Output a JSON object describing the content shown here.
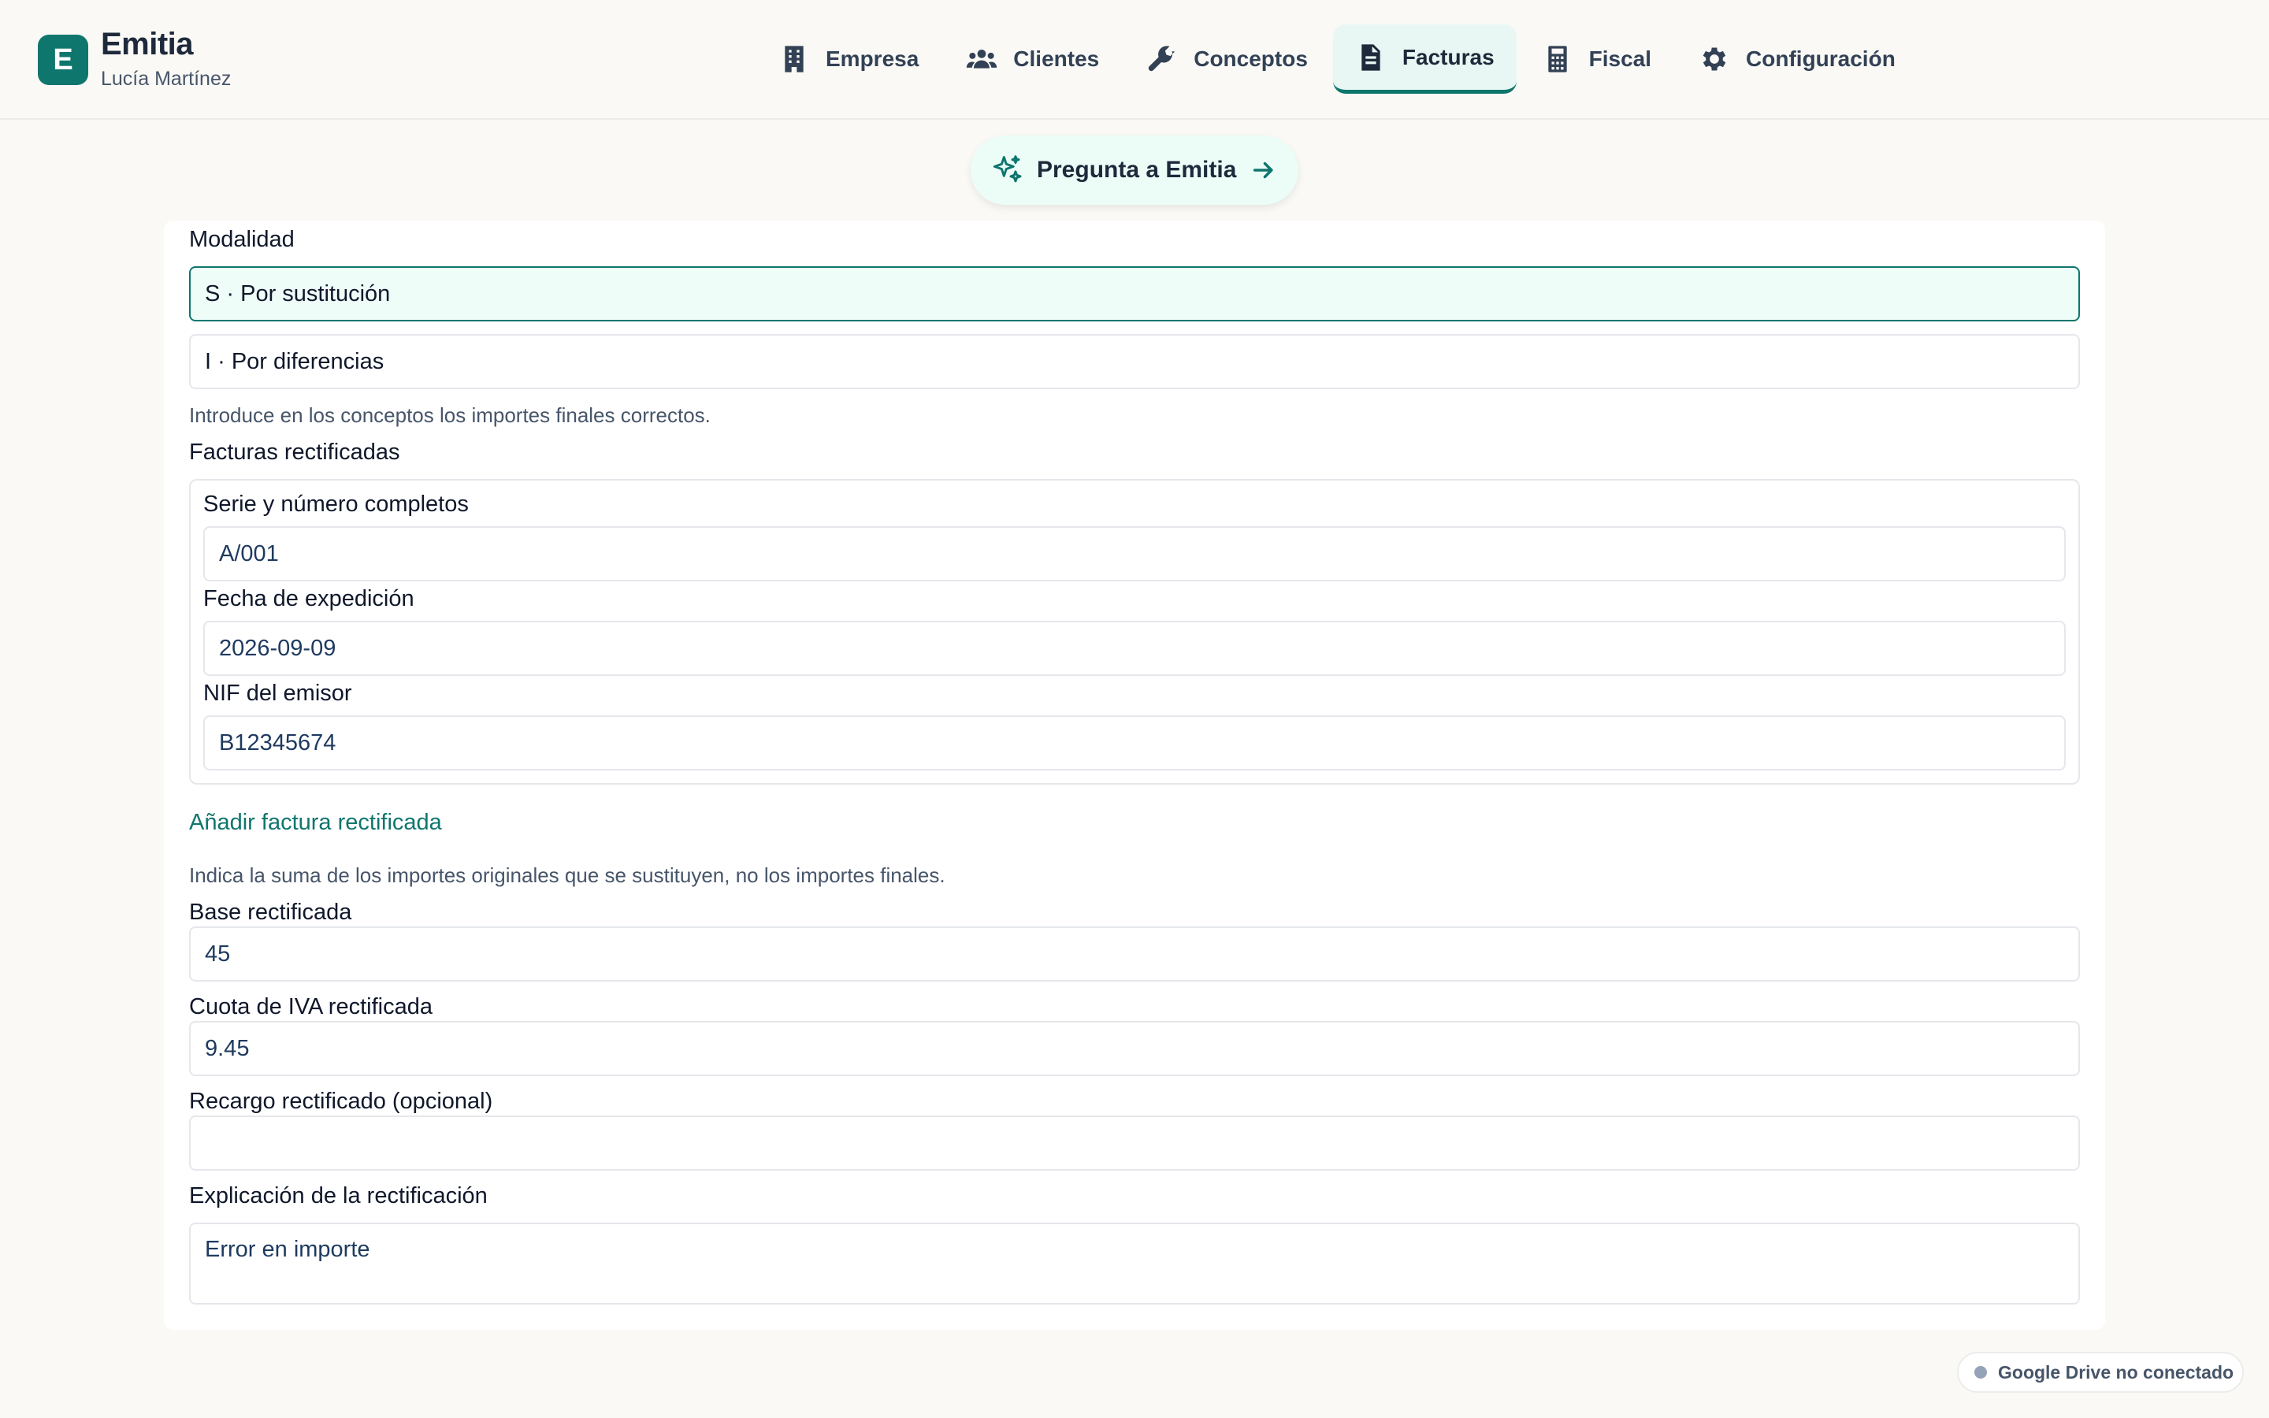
{
  "brand": {
    "initial": "E",
    "name": "Emitia",
    "user": "Lucía Martínez"
  },
  "nav": [
    {
      "label": "Empresa",
      "icon": "building-icon",
      "active": false
    },
    {
      "label": "Clientes",
      "icon": "users-icon",
      "active": false
    },
    {
      "label": "Conceptos",
      "icon": "wrench-icon",
      "active": false
    },
    {
      "label": "Facturas",
      "icon": "document-icon",
      "active": true
    },
    {
      "label": "Fiscal",
      "icon": "calculator-icon",
      "active": false
    },
    {
      "label": "Configuración",
      "icon": "gear-icon",
      "active": false
    }
  ],
  "ask": {
    "label": "Pregunta a Emitia"
  },
  "form": {
    "modalidad_label": "Modalidad",
    "options": [
      "S · Por sustitución",
      "I · Por diferencias"
    ],
    "selected_option": "S · Por sustitución",
    "modalidad_help": "Introduce en los conceptos los importes finales correctos.",
    "rectificadas_label": "Facturas rectificadas",
    "rectificada": {
      "serie_label": "Serie y número completos",
      "serie_value": "A/001",
      "fecha_label": "Fecha de expedición",
      "fecha_value": "2026-09-09",
      "nif_label": "NIF del emisor",
      "nif_value": "B12345674"
    },
    "add_link": "Añadir factura rectificada",
    "importes_help": "Indica la suma de los importes originales que se sustituyen, no los importes finales.",
    "base_label": "Base rectificada",
    "base_value": "45",
    "cuota_label": "Cuota de IVA rectificada",
    "cuota_value": "9.45",
    "recargo_label": "Recargo rectificado (opcional)",
    "recargo_value": "",
    "explicacion_label": "Explicación de la rectificación",
    "explicacion_value": "Error en importe"
  },
  "status": {
    "drive": "Google Drive no conectado"
  },
  "colors": {
    "accent": "#0f766e",
    "accent_bg": "#e8f7f3",
    "background": "#faf9f6"
  }
}
